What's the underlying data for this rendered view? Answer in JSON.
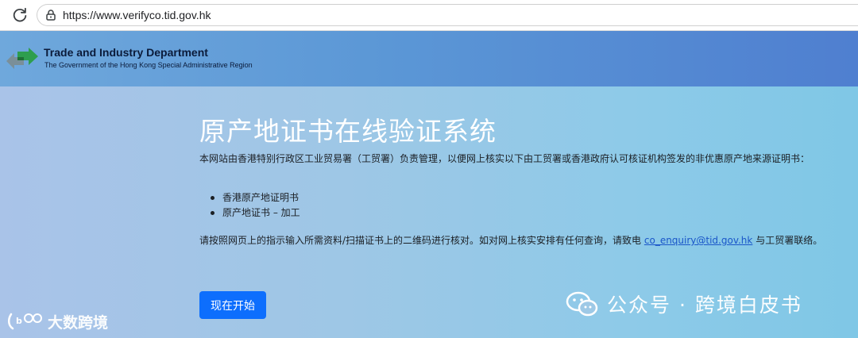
{
  "browser": {
    "url": "https://www.verifyco.tid.gov.hk"
  },
  "header": {
    "department": "Trade and Industry Department",
    "subtitle": "The Government of the Hong Kong Special Administrative Region"
  },
  "main": {
    "title": "原产地证书在线验证系统",
    "intro": "本网站由香港特别行政区工业贸易署（工贸署）负责管理，以便网上核实以下由工贸署或香港政府认可核证机构签发的非优惠原产地来源证明书：",
    "items": [
      {
        "label": "香港原产地证明书"
      },
      {
        "label": "原产地证书 – 加工"
      }
    ],
    "note_prefix": "请按照网页上的指示输入所需资料/扫描证书上的二维码进行核对。如对网上核实安排有任何查询，请致电 ",
    "email": "co_enquiry@tid.gov.hk",
    "note_suffix": " 与工贸署联络。",
    "start_button": "现在开始"
  },
  "watermarks": {
    "left": "大数跨境",
    "right": "公众号 · 跨境白皮书"
  },
  "colors": {
    "header_accent": "#4f7fd0",
    "button": "#0d6efd",
    "link": "#1a56c9"
  }
}
